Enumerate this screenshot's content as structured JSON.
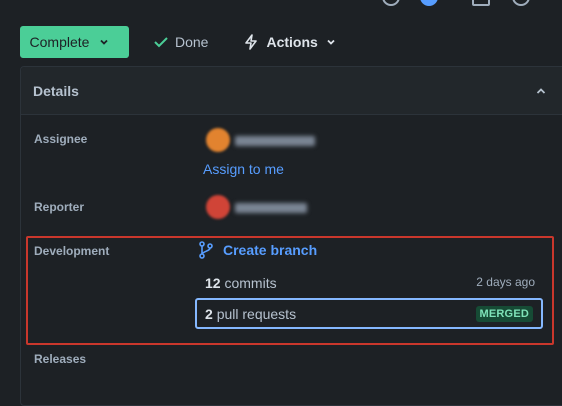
{
  "toolbar": {
    "complete_label": "Complete",
    "done_label": "Done",
    "actions_label": "Actions"
  },
  "details": {
    "title": "Details",
    "assignee": {
      "label": "Assignee",
      "assign_to_me": "Assign to me"
    },
    "reporter": {
      "label": "Reporter"
    },
    "development": {
      "label": "Development",
      "create_branch": "Create branch",
      "commits_count": "12",
      "commits_label": "commits",
      "commits_time": "2 days ago",
      "pr_count": "2",
      "pr_label": "pull requests",
      "pr_status": "MERGED"
    },
    "releases": {
      "label": "Releases"
    }
  },
  "icons": [
    "chevron-down-icon",
    "check-icon",
    "lightning-icon",
    "chevron-up-icon",
    "branch-icon"
  ],
  "colors": {
    "accent_green": "#4bce97",
    "link_blue": "#579dff",
    "highlight_red": "#c9372c",
    "merged_badge_bg": "#164b35",
    "merged_badge_text": "#7ee2b8"
  }
}
